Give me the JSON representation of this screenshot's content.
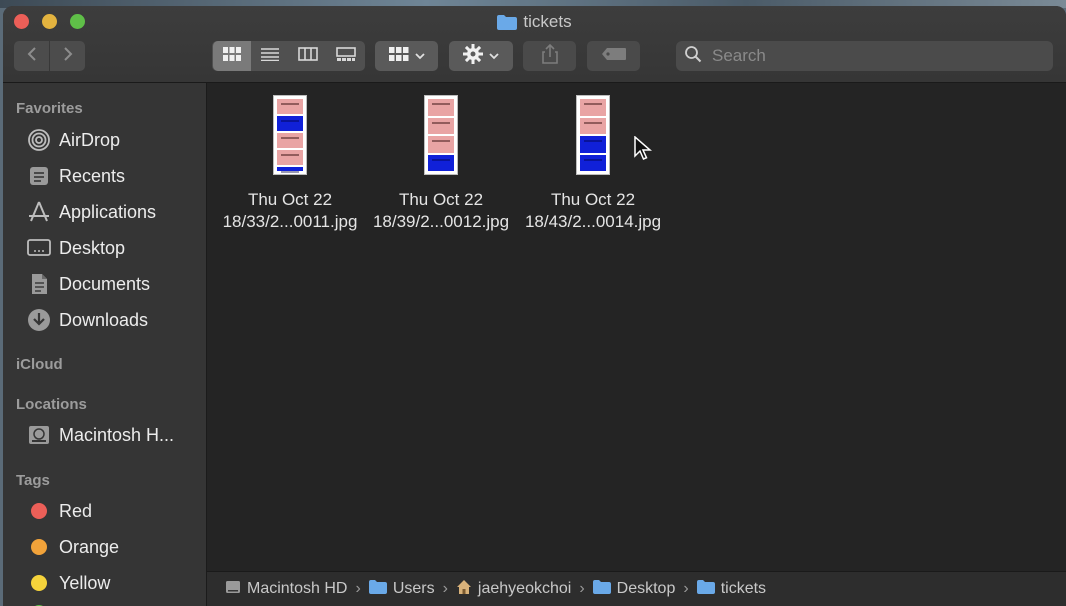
{
  "window": {
    "title": "tickets"
  },
  "toolbar": {
    "search_placeholder": "Search",
    "views": [
      "icon-view",
      "list-view",
      "column-view",
      "gallery-view"
    ]
  },
  "sidebar": {
    "favorites_header": "Favorites",
    "favorites": [
      {
        "label": "AirDrop",
        "icon": "airdrop-icon"
      },
      {
        "label": "Recents",
        "icon": "recents-icon"
      },
      {
        "label": "Applications",
        "icon": "applications-icon"
      },
      {
        "label": "Desktop",
        "icon": "desktop-icon"
      },
      {
        "label": "Documents",
        "icon": "documents-icon"
      },
      {
        "label": "Downloads",
        "icon": "downloads-icon"
      }
    ],
    "icloud_header": "iCloud",
    "locations_header": "Locations",
    "locations": [
      {
        "label": "Macintosh H...",
        "icon": "hard-drive-icon"
      }
    ],
    "tags_header": "Tags",
    "tags": [
      {
        "label": "Red",
        "color": "#ec5f58"
      },
      {
        "label": "Orange",
        "color": "#f2a33a"
      },
      {
        "label": "Yellow",
        "color": "#f5d33b"
      }
    ]
  },
  "files": [
    {
      "line1": "Thu Oct 22",
      "line2": "18/33/2...0011.jpg"
    },
    {
      "line1": "Thu Oct 22",
      "line2": "18/39/2...0012.jpg"
    },
    {
      "line1": "Thu Oct 22",
      "line2": "18/43/2...0014.jpg"
    }
  ],
  "pathbar": {
    "crumbs": [
      {
        "label": "Macintosh HD",
        "icon": "hard-drive-icon"
      },
      {
        "label": "Users",
        "icon": "folder-icon"
      },
      {
        "label": "jaehyeokchoi",
        "icon": "home-icon"
      },
      {
        "label": "Desktop",
        "icon": "folder-icon"
      },
      {
        "label": "tickets",
        "icon": "folder-icon"
      }
    ]
  },
  "colors": {
    "accent_folder": "#6aa9e8",
    "ticket_pink": "#e9a4a4",
    "ticket_blue": "#1020d8"
  }
}
